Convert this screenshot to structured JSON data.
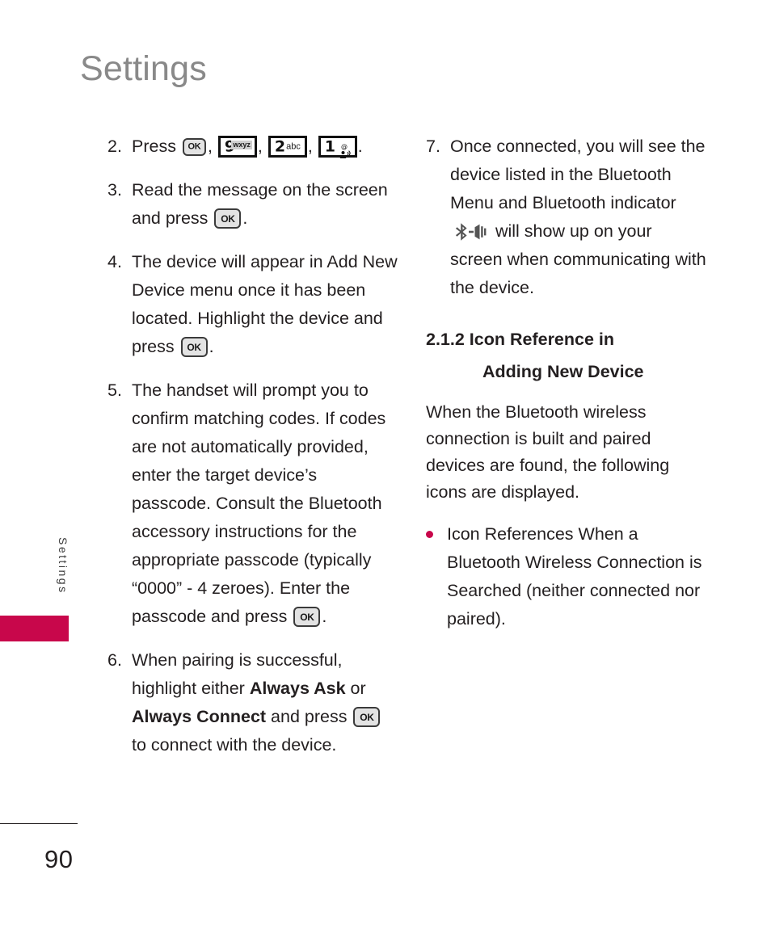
{
  "page": {
    "title": "Settings",
    "side_tab_label": "Settings",
    "page_number": "90",
    "accent_color": "#c8074b",
    "title_color": "#898989",
    "text_color": "#231f20"
  },
  "left_column": {
    "steps": [
      {
        "num": "2.",
        "prefix": "Press ",
        "keys": [
          "OK",
          "9 wxyz",
          "2 abc",
          "1 @"
        ],
        "suffix": ".",
        "type": "keys"
      },
      {
        "num": "3.",
        "text_before": "Read the message on the screen and press ",
        "key": "OK",
        "text_after": ".",
        "type": "text-key"
      },
      {
        "num": "4.",
        "text_before": "The device will appear in Add New Device menu once it has been located. Highlight the device and press ",
        "key": "OK",
        "text_after": ".",
        "type": "text-key"
      },
      {
        "num": "5.",
        "text_before": "The handset will prompt you to confirm matching codes. If codes are not automatically provided, enter the target device’s passcode. Consult the Bluetooth accessory instructions for the appropriate passcode (typically “0000” - 4 zeroes). Enter the passcode and press ",
        "key": "OK",
        "text_after": ".",
        "type": "text-key"
      },
      {
        "num": "6.",
        "type": "bold-mix",
        "seg1": "When pairing is successful, highlight either ",
        "bold1": "Always Ask",
        "seg2": " or ",
        "bold2": "Always Connect",
        "seg3": " and press ",
        "key": "OK",
        "seg4": " to connect with the device."
      }
    ]
  },
  "right_column": {
    "step7": {
      "num": "7.",
      "text_before": "Once connected, you will see the device listed in the Bluetooth Menu and Bluetooth indicator ",
      "icon": "bluetooth-connected-indicator-icon",
      "text_after": " will show up on your screen when communicating with the device."
    },
    "section_heading": {
      "line1": "2.1.2 Icon Reference in",
      "line2": "Adding New Device"
    },
    "paragraph": "When the Bluetooth wireless connection is built and paired devices are found, the following icons are displayed.",
    "bullets": [
      "Icon References When a Bluetooth Wireless Connection is Searched (neither connected nor paired)."
    ]
  },
  "key_glyphs": {
    "ok": "OK",
    "nine_digit": "9",
    "nine_letters": "wxyz",
    "two_digit": "2",
    "two_letters": "abc",
    "one_digit": "1",
    "one_symbol": "@"
  }
}
